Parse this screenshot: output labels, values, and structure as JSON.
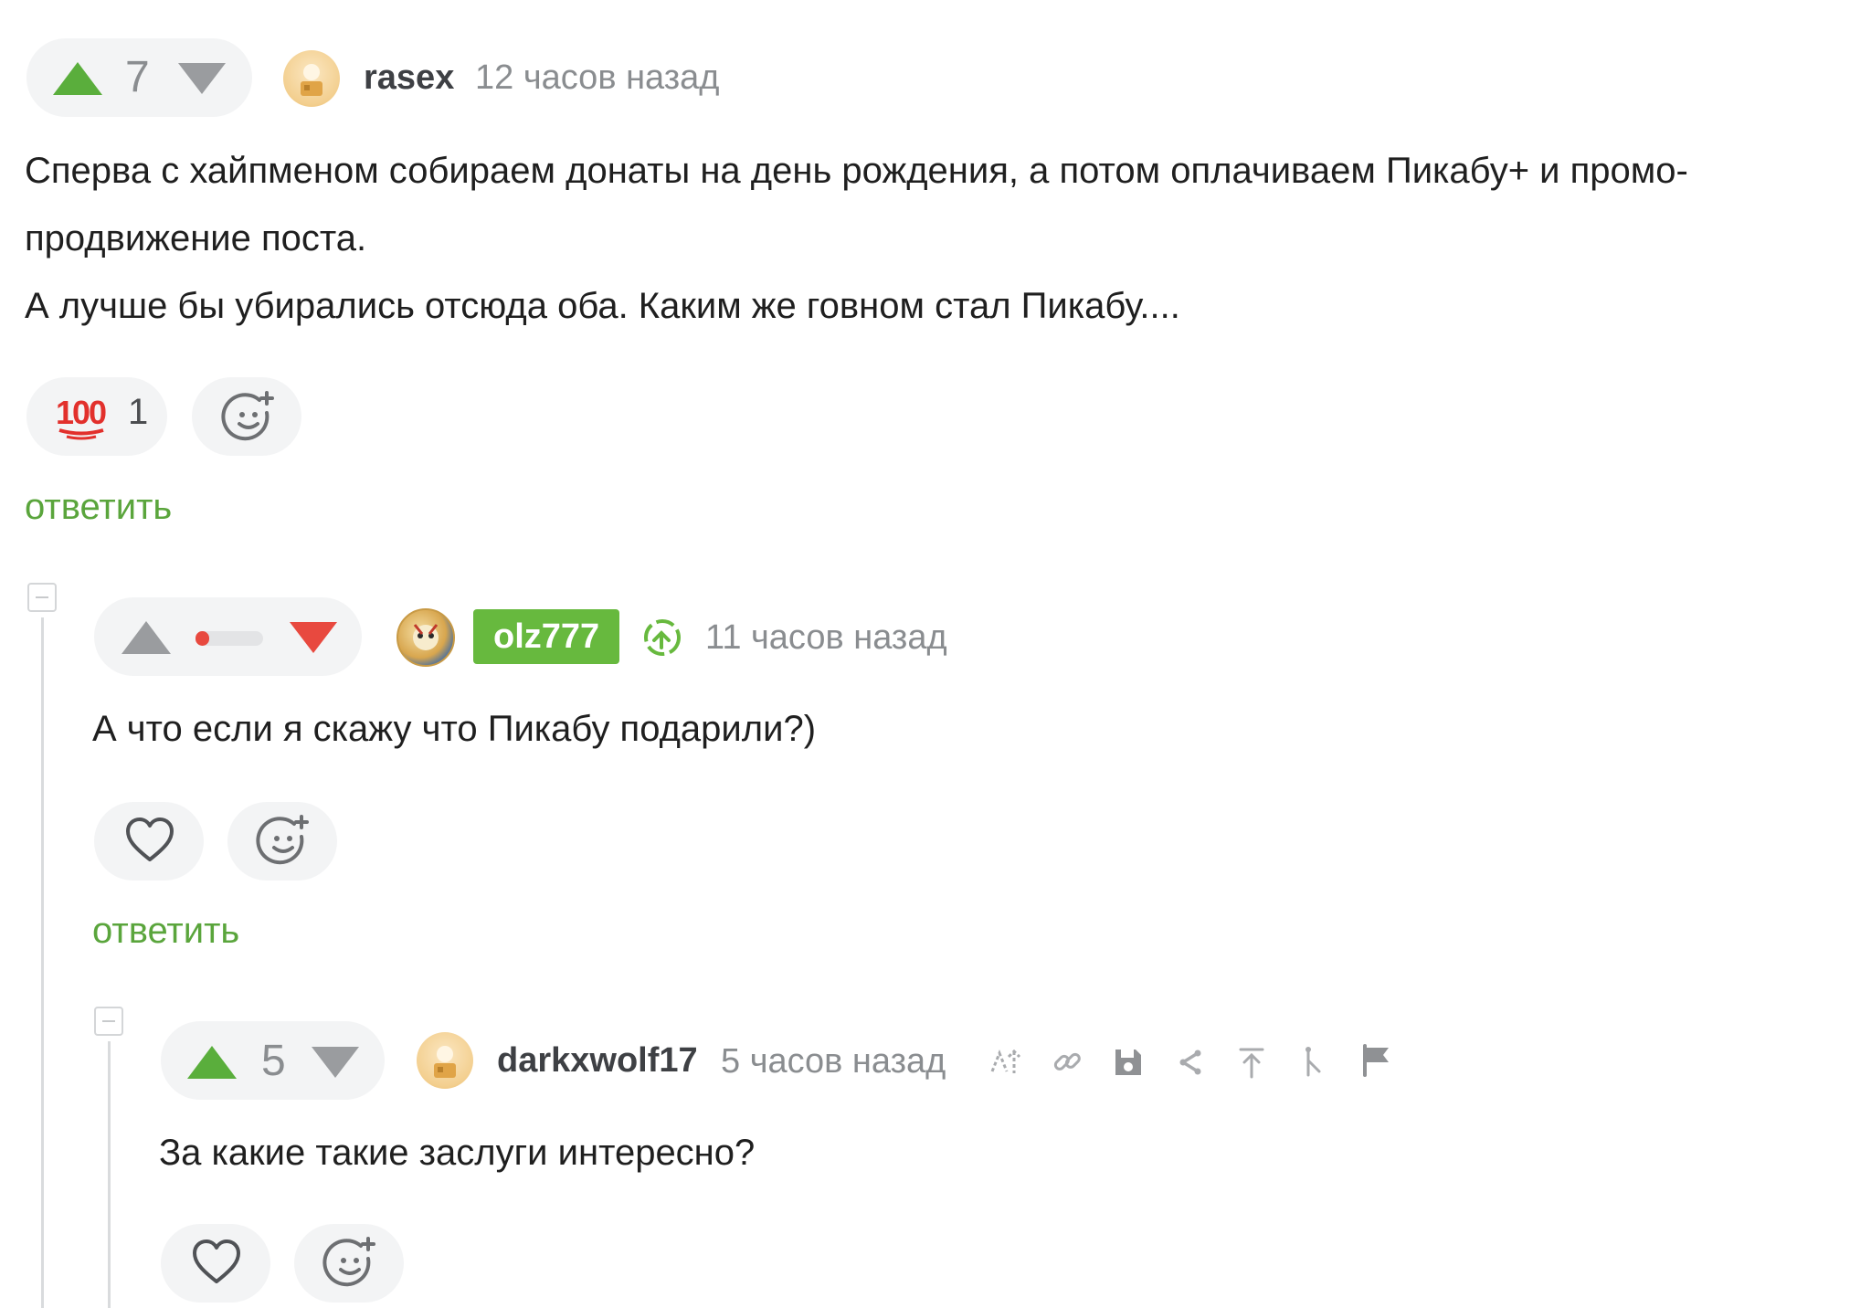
{
  "comments": [
    {
      "rating": "7",
      "username": "rasex",
      "time": "12 часов назад",
      "text_lines": [
        "Сперва с хайпменом собираем донаты на день рождения, а потом оплачиваем Пикабу+ и промо-",
        "продвижение поста.",
        "А лучше бы убирались отсюда оба. Каким же говном стал Пикабу...."
      ],
      "reaction": {
        "emoji_label": "100",
        "count": "1"
      },
      "reply_label": "ответить"
    },
    {
      "rating_level": 0.2,
      "username": "olz777",
      "time": "11 часов назад",
      "text": "А что если я скажу что Пикабу подарили?)",
      "reply_label": "ответить"
    },
    {
      "rating": "5",
      "username": "darkxwolf17",
      "time": "5 часов назад",
      "text": "За какие такие заслуги интересно?"
    }
  ],
  "colors": {
    "upvote": "#5aae3c",
    "downvote": "#e8493f",
    "neutral_arrow": "#9a9c9f",
    "accent_green": "#67b93e",
    "pill_bg": "#f3f4f5"
  },
  "icons": [
    "upvote-icon",
    "downvote-icon",
    "add-reaction-icon",
    "heart-icon",
    "hundred-emoji-icon",
    "branch-icon",
    "link-icon",
    "save-icon",
    "share-icon",
    "go-to-parent-icon",
    "thread-icon",
    "report-flag-icon"
  ]
}
